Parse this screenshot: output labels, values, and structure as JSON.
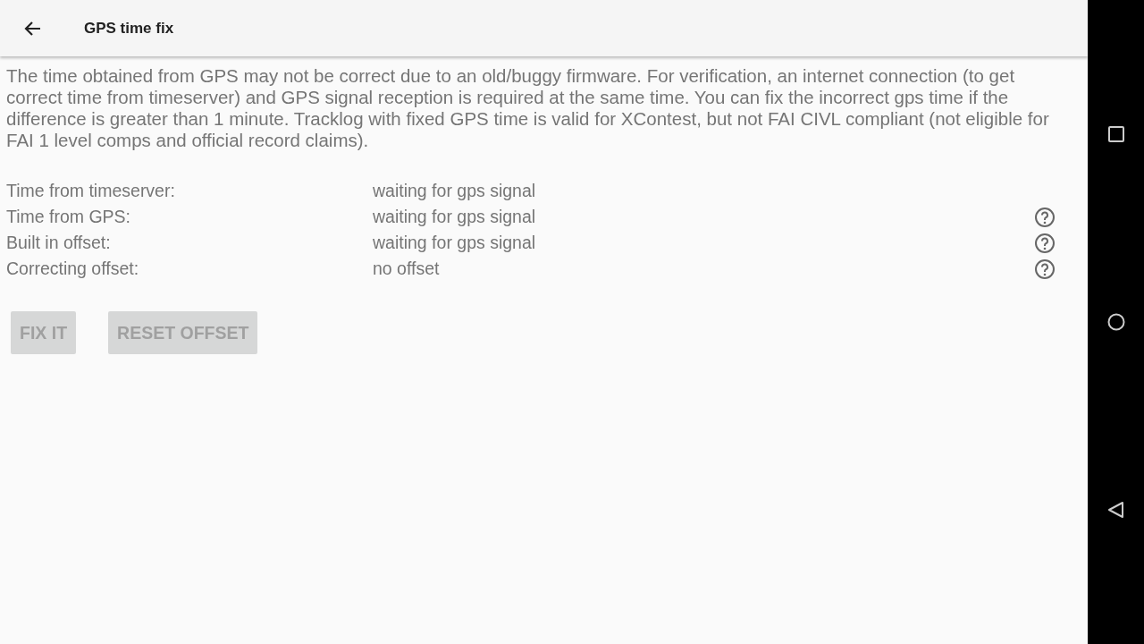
{
  "toolbar": {
    "title": "GPS time fix"
  },
  "description": "The time obtained from GPS may not be correct due to an old/buggy firmware. For verification, an internet connection (to get correct time from timeserver) and GPS signal reception is required at the same time. You can fix the incorrect gps time if the difference is greater than 1 minute. Tracklog with fixed GPS time is valid for XContest, but not FAI CIVL compliant (not eligible for FAI 1 level comps and official record claims).",
  "rows": [
    {
      "label": "Time from timeserver:",
      "value": "waiting for gps signal",
      "help": false
    },
    {
      "label": "Time from GPS:",
      "value": "waiting for gps signal",
      "help": true
    },
    {
      "label": "Built in offset:",
      "value": "waiting for gps signal",
      "help": true
    },
    {
      "label": "Correcting offset:",
      "value": "no offset",
      "help": true
    }
  ],
  "buttons": [
    {
      "label": "FIX IT",
      "disabled": true
    },
    {
      "label": "RESET OFFSET",
      "disabled": true
    }
  ]
}
